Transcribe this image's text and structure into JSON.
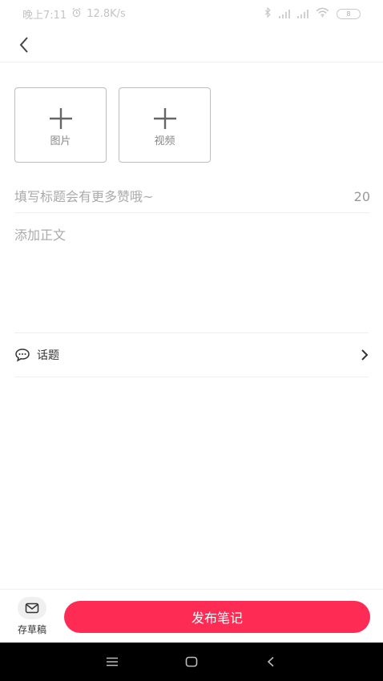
{
  "status_bar": {
    "time": "晚上7:11",
    "net_speed": "12.8K/s",
    "battery": "8"
  },
  "media": {
    "image_label": "图片",
    "video_label": "视频"
  },
  "title": {
    "placeholder": "填写标题会有更多赞哦~",
    "counter": "20"
  },
  "body": {
    "placeholder": "添加正文"
  },
  "topic": {
    "label": "话题"
  },
  "bottom": {
    "draft_label": "存草稿",
    "publish_label": "发布笔记"
  },
  "colors": {
    "accent": "#fe2c55",
    "border": "#bdbdbd",
    "placeholder": "#aaaaaa"
  }
}
